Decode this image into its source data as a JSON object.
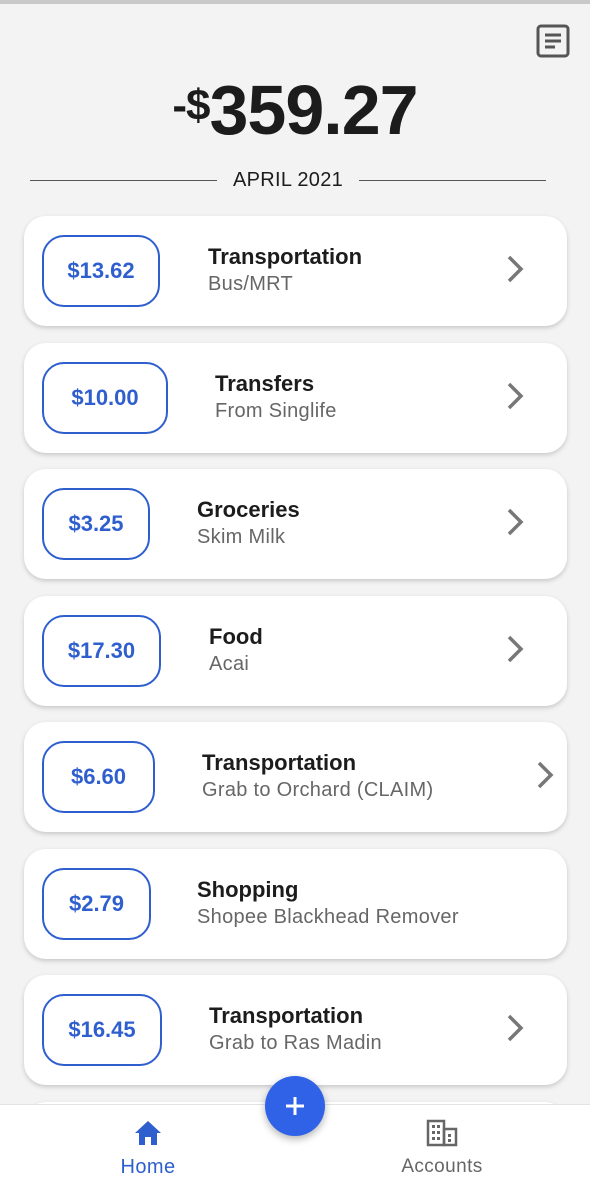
{
  "header": {
    "report_icon": "list-document-icon",
    "total_sign": "-$",
    "total_amount": "359.27",
    "month": "APRIL 2021"
  },
  "transactions": [
    {
      "amount": "$13.62",
      "category": "Transportation",
      "description": "Bus/MRT",
      "has_chevron": true
    },
    {
      "amount": "$10.00",
      "category": "Transfers",
      "description": "From Singlife",
      "has_chevron": true
    },
    {
      "amount": "$3.25",
      "category": "Groceries",
      "description": "Skim Milk",
      "has_chevron": true
    },
    {
      "amount": "$17.30",
      "category": "Food",
      "description": "Acai",
      "has_chevron": true
    },
    {
      "amount": "$6.60",
      "category": "Transportation",
      "description": "Grab to Orchard (CLAIM)",
      "has_chevron": true
    },
    {
      "amount": "$2.79",
      "category": "Shopping",
      "description": "Shopee Blackhead Remover",
      "has_chevron": false
    },
    {
      "amount": "$16.45",
      "category": "Transportation",
      "description": "Grab to Ras Madin",
      "has_chevron": true
    }
  ],
  "bottom_nav": {
    "home_label": "Home",
    "home_icon": "home-icon",
    "accounts_label": "Accounts",
    "accounts_icon": "building-icon",
    "add_icon": "plus-icon"
  },
  "colors": {
    "accent": "#2f5fcf",
    "fab": "#2f62e6",
    "background": "#f3f3f3"
  }
}
